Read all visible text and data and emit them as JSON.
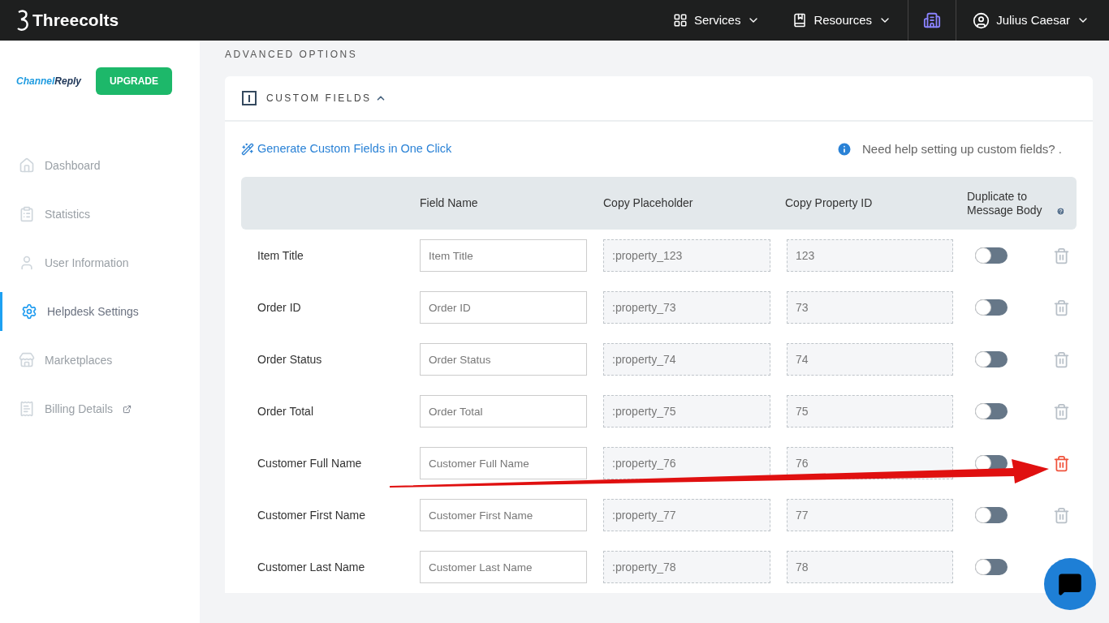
{
  "topbar": {
    "brand": "Threecolts",
    "menus": [
      {
        "label": "Services",
        "kind": "grid"
      },
      {
        "label": "Resources",
        "kind": "books"
      }
    ],
    "user": "Julius Caesar"
  },
  "sidebar": {
    "logo": {
      "first": "Channel",
      "second": "Reply"
    },
    "upgrade": "UPGRADE",
    "items": [
      {
        "label": "Dashboard",
        "kind": "home",
        "selected": false
      },
      {
        "label": "Statistics",
        "kind": "clipboard",
        "selected": false
      },
      {
        "label": "User Information",
        "kind": "user",
        "selected": false
      },
      {
        "label": "Helpdesk Settings",
        "kind": "gear",
        "selected": true
      },
      {
        "label": "Marketplaces",
        "kind": "store",
        "selected": false
      },
      {
        "label": "Billing Details",
        "kind": "receipt",
        "selected": false,
        "external": true
      }
    ]
  },
  "section_title": "ADVANCED OPTIONS",
  "panel": {
    "title": "CUSTOM FIELDS",
    "expanded": true,
    "generate_link": "Generate Custom Fields in One Click",
    "help": "Need help setting up custom fields? .",
    "columns": [
      "Field Name",
      "Copy Placeholder",
      "Copy Property ID",
      "Duplicate to Message Body"
    ],
    "rows": [
      {
        "label": "Item Title",
        "placeholder": "Item Title",
        "copy_placeholder": ":property_123",
        "property_id": "123",
        "on": false,
        "highlighted": false
      },
      {
        "label": "Order ID",
        "placeholder": "Order ID",
        "copy_placeholder": ":property_73",
        "property_id": "73",
        "on": false,
        "highlighted": false
      },
      {
        "label": "Order Status",
        "placeholder": "Order Status",
        "copy_placeholder": ":property_74",
        "property_id": "74",
        "on": false,
        "highlighted": false
      },
      {
        "label": "Order Total",
        "placeholder": "Order Total",
        "copy_placeholder": ":property_75",
        "property_id": "75",
        "on": false,
        "highlighted": false
      },
      {
        "label": "Customer Full Name",
        "placeholder": "Customer Full Name",
        "copy_placeholder": ":property_76",
        "property_id": "76",
        "on": false,
        "highlighted": true
      },
      {
        "label": "Customer First Name",
        "placeholder": "Customer First Name",
        "copy_placeholder": ":property_77",
        "property_id": "77",
        "on": false,
        "highlighted": false
      },
      {
        "label": "Customer Last Name",
        "placeholder": "Customer Last Name",
        "copy_placeholder": ":property_78",
        "property_id": "78",
        "on": false,
        "highlighted": false
      }
    ]
  }
}
